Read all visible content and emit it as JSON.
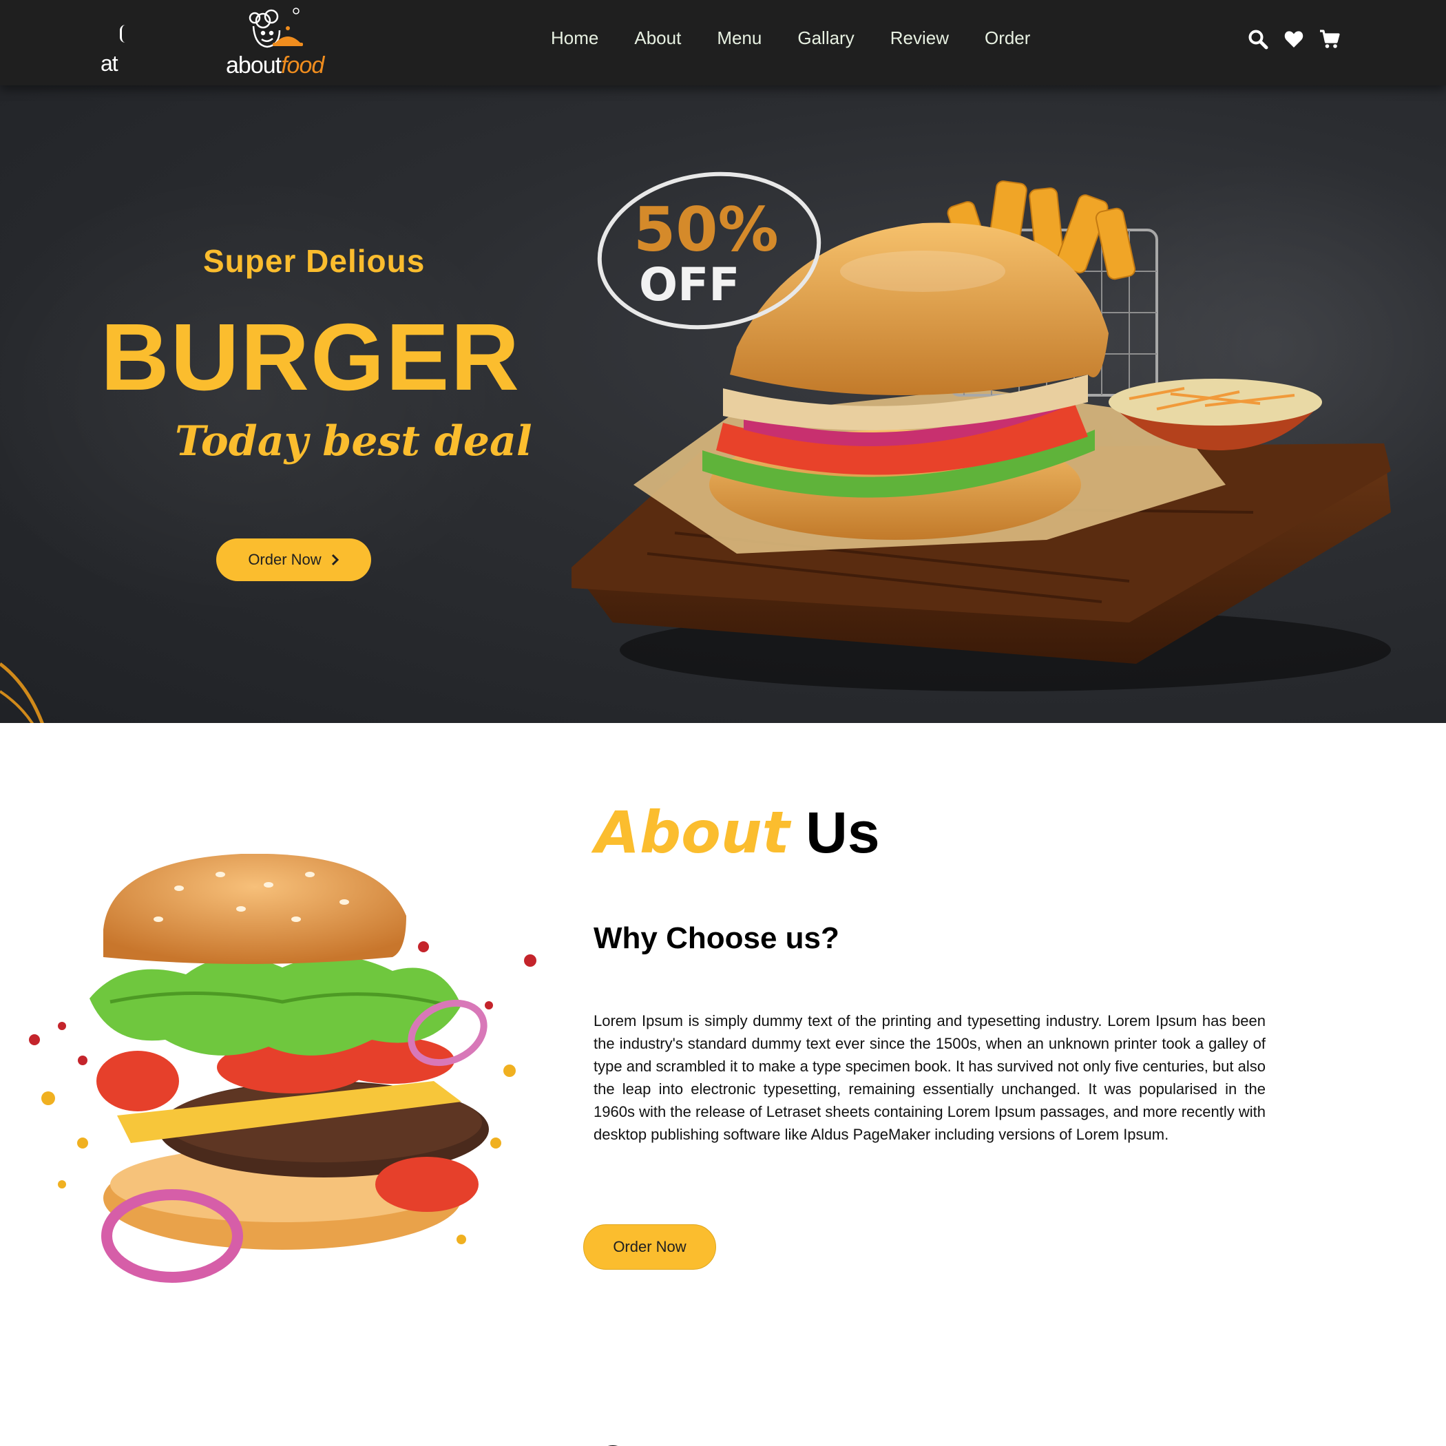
{
  "nav": {
    "brand_small": "at",
    "brand": {
      "about": "about",
      "food": "food"
    },
    "links": [
      "Home",
      "About",
      "Menu",
      "Gallary",
      "Review",
      "Order"
    ],
    "icons": [
      "search-icon",
      "heart-icon",
      "cart-icon"
    ]
  },
  "hero": {
    "subtitle": "Super Delious",
    "title": "BURGER",
    "tagline": "Today best deal",
    "cta": "Order Now",
    "badge": {
      "percent": "50%",
      "off": "OFF"
    }
  },
  "about": {
    "title_highlight": "About",
    "title_rest": "Us",
    "heading": "Why Choose us?",
    "paragraph": "Lorem Ipsum is simply dummy text of the printing and typesetting industry. Lorem Ipsum has been the industry's standard dummy text ever since the 1500s, when an unknown printer took a galley of type and scrambled it to make a type specimen book. It has survived not only five centuries, but also the leap into electronic typesetting, remaining essentially unchanged. It was popularised in the 1960s with the release of Letraset sheets containing Lorem Ipsum passages, and more recently with desktop publishing software like Aldus PageMaker including versions of Lorem Ipsum.",
    "cta": "Order Now"
  },
  "colors": {
    "accent": "#fbbd2e",
    "nav_bg": "#1f1f1f",
    "hero_bg": "#2b2d31",
    "nav_text": "#e7f0e1",
    "logo_food": "#f08d1e"
  }
}
